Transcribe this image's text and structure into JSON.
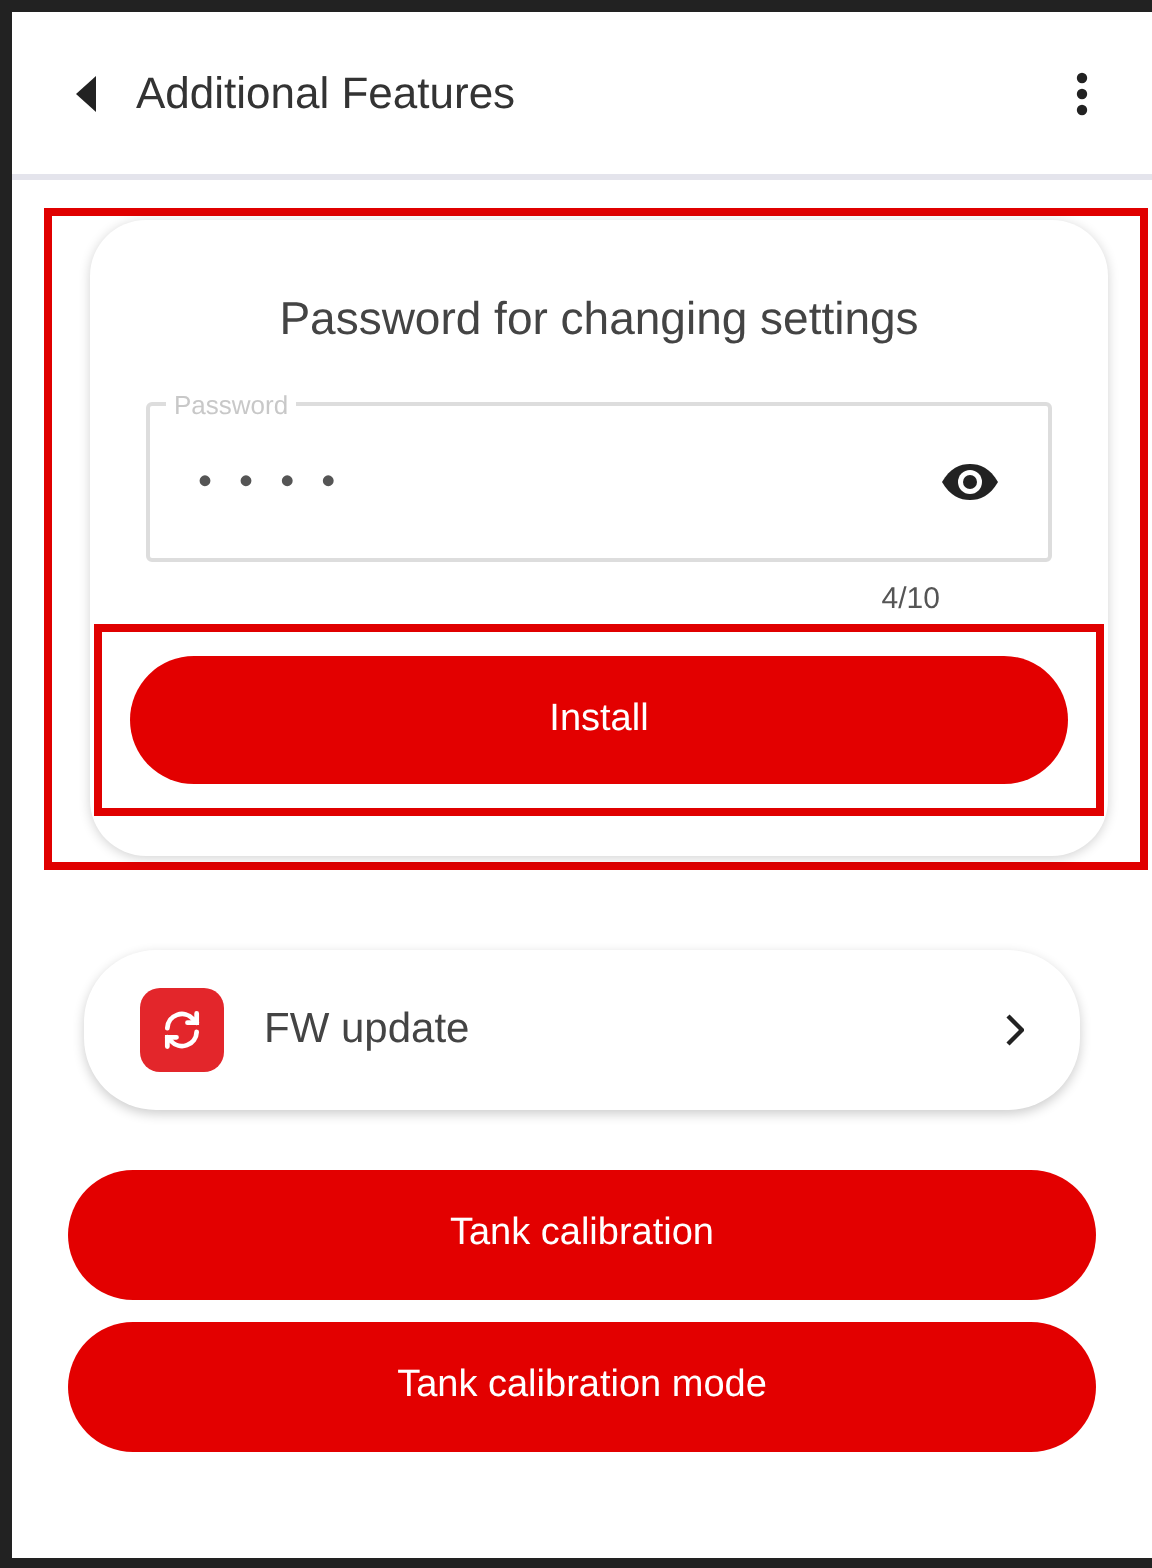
{
  "header": {
    "title": "Additional Features"
  },
  "password_card": {
    "highlighted": true,
    "title": "Password for changing settings",
    "field": {
      "label": "Password",
      "value": "• • • •",
      "counter": "4/10"
    },
    "install_button": {
      "label": "Install",
      "highlighted": true
    }
  },
  "fw_update": {
    "label": "FW update"
  },
  "buttons": [
    "Tank calibration",
    "Tank calibration mode"
  ]
}
